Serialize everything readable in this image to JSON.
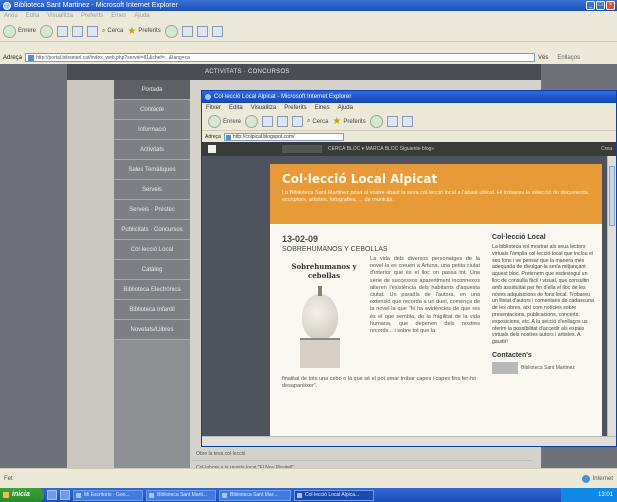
{
  "outer_window": {
    "title": "Biblioteca Sant Martinez - Microsoft Internet Explorer",
    "menu": [
      "Arxiu",
      "Edita",
      "Visualitza",
      "Preferits",
      "Eines",
      "Ajuda"
    ],
    "toolbar": {
      "back": "Enrere",
      "search": "Cerca",
      "favorites": "Preferits"
    },
    "address_label": "Adreça",
    "address": "http://portal.bibsetarl.cat/index_web.php?servei=81&chef=...&lang=ca",
    "go_label": "Vés",
    "links_label": "Enllaços",
    "status_text": "Fet",
    "zone_text": "Internet"
  },
  "outer_page": {
    "header": "ACTIVITATS · CONCURSOS",
    "sidebar": [
      "Portada",
      "Contacte",
      "Informació",
      "Activitats",
      "Sales Temàtiques",
      "Serveis",
      "Serveis · Préstec",
      "Publicitats · Concursos",
      "Col·lecció Local",
      "Catàleg",
      "Biblioteca Electrònica",
      "Biblioteca Infantil",
      "Novetats/Llibres"
    ],
    "footer_lines": [
      "Obre la teva col·lecció",
      "Col·labora a la revista local \"El Nou Pinatell\""
    ]
  },
  "inner_window": {
    "title": "Col·lecció Local Alpicat - Microsoft Internet Explorer",
    "menu": [
      "Fitxer",
      "Edita",
      "Visualitza",
      "Preferits",
      "Eines",
      "Ajuda"
    ],
    "toolbar": {
      "back": "Enrere",
      "search": "Cerca",
      "favorites": "Preferits"
    },
    "address_label": "Adreça",
    "address": "http://colpical.blogspot.com/",
    "blogbar_text": "CERCA BLOC  ▾ MARCA BLOC  Siguiente blog»",
    "blogbar_right": "Crea"
  },
  "blog": {
    "title": "Col·lecció Local Alpicat",
    "description": "La Biblioteca Sant Martinez posa al vostre abast la seva col·lecció local a l'abast ubicat. Hi trobareu la selecció de documents, escriptors, artistes, fotografies, ... de municipi.",
    "post": {
      "date": "13-02-09",
      "title": "SOBREHUMANOS Y CEBOLLAS",
      "image_title": "Sobrehumanos y cebollas",
      "text": "La vida dels diversos personatges de la novel·la es creuen a Artuna, una petita ciutat d'interior que és el lloc on passa tot. Una sèrie de successos aparentment inconnexos alteren l'existència dels habitants d'aquesta ciutat. Un paradís de l'autora, en una extensió que recorda a un duel, comença de la novel·la que \"hi ha evidències de que res és el que sembla, de la fragilitat de la vida humana, que depenen dels nostres records... i sobre tot que la",
      "tail": "finalitat de tots una cebo o la que sé el pot amar trobar capes i capes fins fer-ho desaparèixer\"."
    },
    "sidebar": {
      "title": "Col·lecció Local",
      "text": "La biblioteca vol mostrar als seus lectors virtuals l'àmplia col·lecció local que inclou el seu fons i ve pensar que la manera més adequada de divulgar-la sería mitjançant aquest bloc. Pretenem que esdevingui un lloc de consulta fàcil i visual, que consultin amb assiduïtat per fer d'ella el lloc de les noves adquisicions de fons local. Trobareu un llistat d'autors i comentaris de cadascuna de les obres, així com notícies sobre presentacions, publicacions, concerts, exposicions, etc. A la secció d'enllaços us oferim la possibilitat d'accedir als espais virtuals dels nostres autors i artistes. A gaudir!",
      "contact_title": "Contacten's",
      "contact_text": "Biblioteca Sant Martinez"
    }
  },
  "taskbar": {
    "start": "inicia",
    "tasks": [
      "Mi Escritorio - Goo...",
      "Biblioteca Sant Marti...",
      "Biblioteca Sant Mar...",
      "Col·lecció Local Alpica..."
    ],
    "clock": "13:01"
  }
}
